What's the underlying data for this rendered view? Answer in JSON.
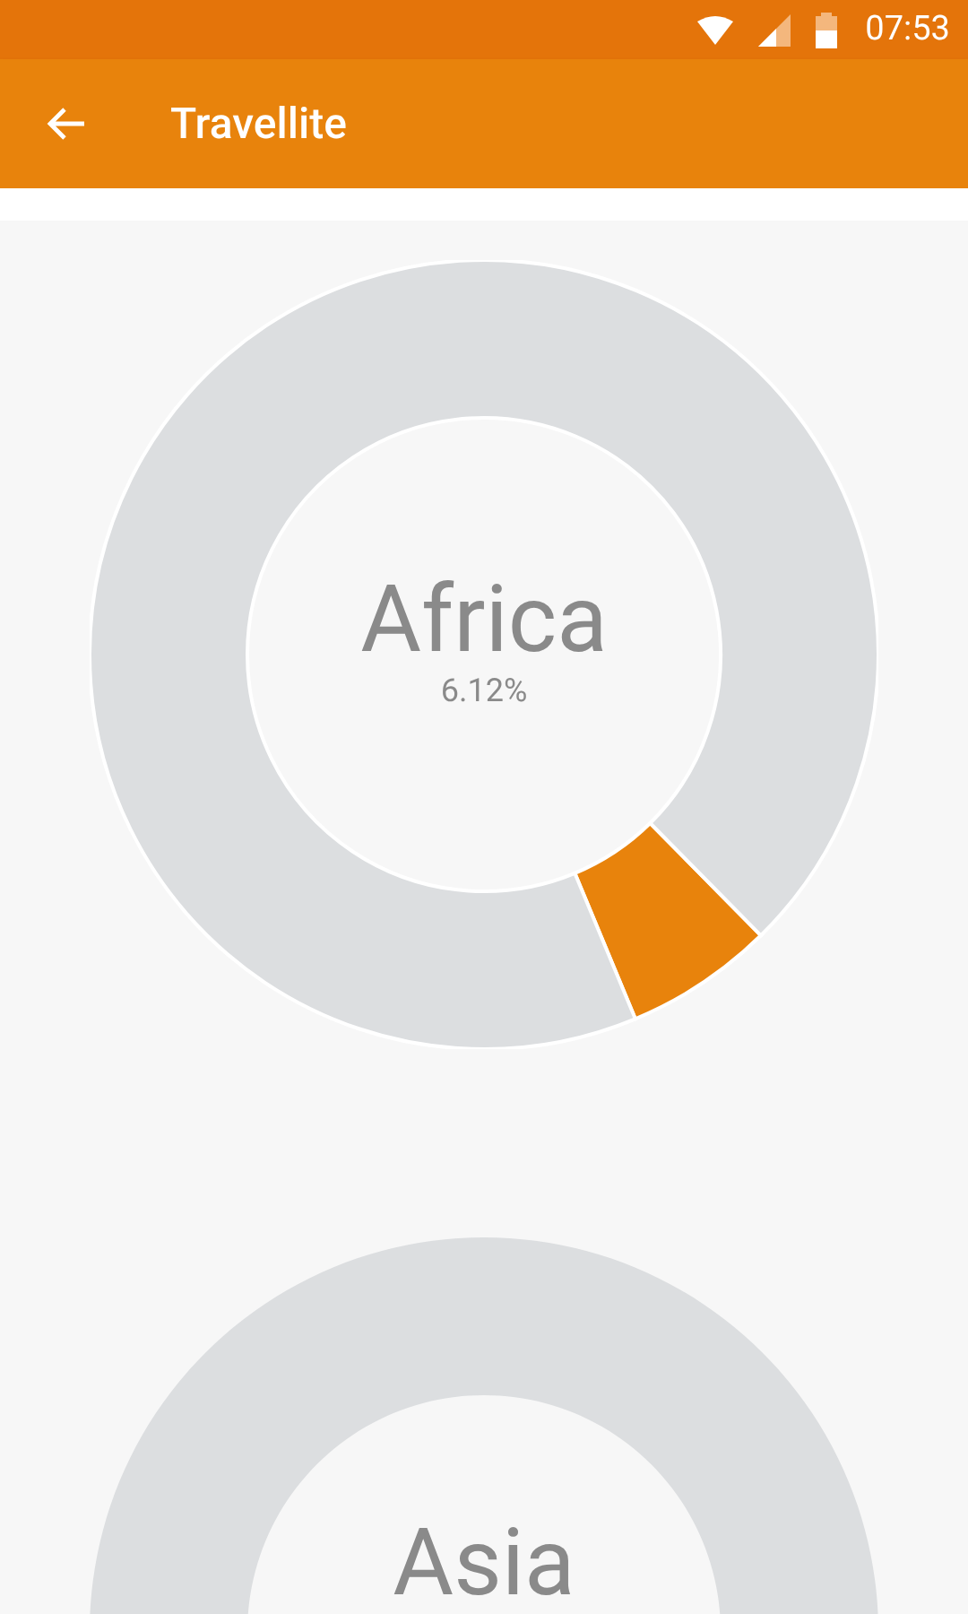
{
  "status_bar": {
    "time": "07:53"
  },
  "app_bar": {
    "title": "Travellite"
  },
  "charts": [
    {
      "title": "Africa",
      "percent": "6.12%",
      "chart_data": {
        "type": "donut",
        "values": [
          6.12,
          93.88
        ],
        "colors": [
          "#e8830c",
          "#dcdee0"
        ]
      }
    },
    {
      "title": "Asia"
    }
  ]
}
